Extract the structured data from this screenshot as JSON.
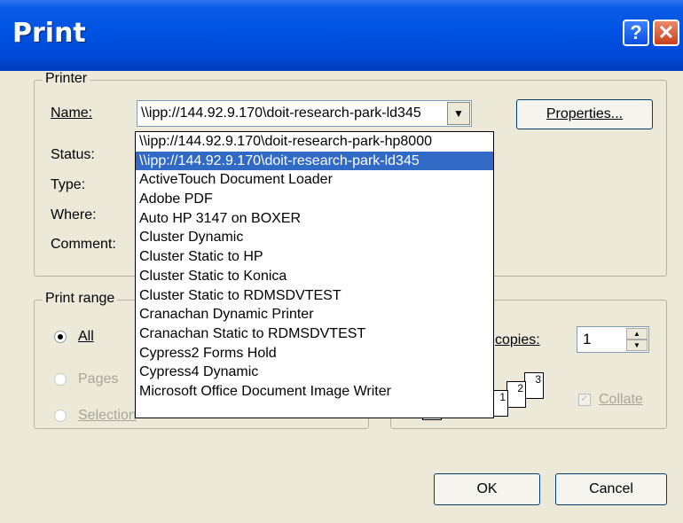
{
  "window": {
    "title": "Print"
  },
  "titlebar": {
    "help_glyph": "?",
    "close_glyph": "✕"
  },
  "printer": {
    "group_label": "Printer",
    "name_label": "Name:",
    "name_value": "\\\\ipp://144.92.9.170\\doit-research-park-ld345",
    "status_label": "Status:",
    "type_label": "Type:",
    "where_label": "Where:",
    "comment_label": "Comment:",
    "properties_button": "Properties..."
  },
  "dropdown": {
    "items": [
      "\\\\ipp://144.92.9.170\\doit-research-park-hp8000",
      "\\\\ipp://144.92.9.170\\doit-research-park-ld345",
      "ActiveTouch Document Loader",
      "Adobe PDF",
      "Auto HP 3147 on BOXER",
      "Cluster Dynamic",
      "Cluster Static to HP",
      "Cluster Static to Konica",
      "Cluster Static to RDMSDVTEST",
      "Cranachan Dynamic Printer",
      "Cranachan Static to RDMSDVTEST",
      "Cypress2 Forms Hold",
      "Cypress4 Dynamic",
      "Microsoft Office Document Image Writer"
    ],
    "selected_index": 1
  },
  "print_range": {
    "group_label": "Print range",
    "all_label": "All",
    "pages_label": "Pages",
    "selection_label": "Selection"
  },
  "copies": {
    "label_partial": "copies:",
    "value": "1",
    "collate_label": "Collate",
    "collate_checked": true,
    "page_numbers": [
      "1",
      "2",
      "3"
    ]
  },
  "buttons": {
    "ok": "OK",
    "cancel": "Cancel"
  },
  "colors": {
    "titlebar": "#0054e3",
    "selection": "#316ac5",
    "dialog_bg": "#ece9d8"
  }
}
